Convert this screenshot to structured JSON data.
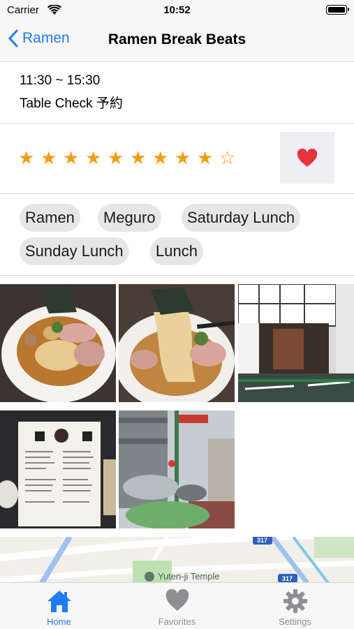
{
  "status_bar": {
    "carrier": "Carrier",
    "time": "10:52"
  },
  "nav": {
    "back_label": "Ramen",
    "title": "Ramen Break Beats"
  },
  "info": {
    "hours": "11:30 ~ 15:30",
    "booking": "Table Check 予約"
  },
  "rating": {
    "value": 9,
    "max": 10,
    "filled_star": "★",
    "empty_star": "☆",
    "color": "#f39c12",
    "favorite": true,
    "heart_color": "#e8333a"
  },
  "tags": [
    "Ramen",
    "Meguro",
    "Saturday Lunch",
    "Sunday Lunch",
    "Lunch"
  ],
  "map": {
    "place_label": "Yuten-ji Temple",
    "route_shields": [
      "317",
      "317"
    ]
  },
  "tab_bar": {
    "active_color": "#1f7bf6",
    "inactive_color": "#8e8e93",
    "tabs": [
      {
        "label": "Home",
        "icon": "house-icon",
        "active": true
      },
      {
        "label": "Favorites",
        "icon": "heart-icon",
        "active": false
      },
      {
        "label": "Settings",
        "icon": "gear-icon",
        "active": false
      }
    ]
  }
}
